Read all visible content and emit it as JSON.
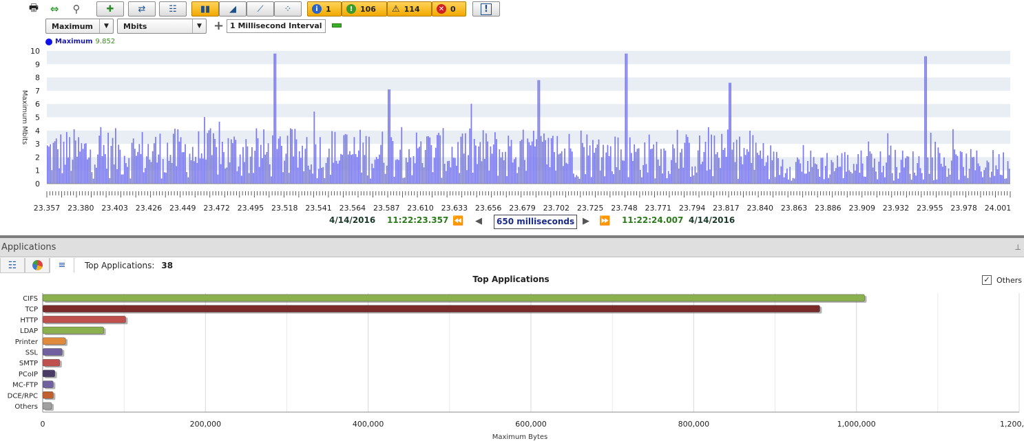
{
  "toolbar": {
    "icons": [
      "printer-icon",
      "refresh-arrows-icon",
      "binoculars-icon"
    ],
    "buttons": [
      "add-filter-icon",
      "swap-icon",
      "table-view-icon"
    ],
    "chart_type_buttons": [
      "bar-chart-icon",
      "area-chart-icon",
      "line-chart-icon",
      "scatter-chart-icon"
    ],
    "alerts": {
      "info": "1",
      "ok": "106",
      "warning": "114",
      "error": "0",
      "exclamation": "!"
    }
  },
  "controls": {
    "metric": "Maximum",
    "unit": "Mbits",
    "interval": "1 Millisecond Interval",
    "plus": "+"
  },
  "legend": {
    "name": "Maximum",
    "value": "9.852"
  },
  "timeline": {
    "start_date": "4/14/2016",
    "start_time": "11:22:23.357",
    "span": "650 milliseconds",
    "end_time": "11:22:24.007",
    "end_date": "4/14/2016"
  },
  "panel": {
    "title": "Applications",
    "pin": "⊥",
    "top_label": "Top Applications:",
    "top_count": "38",
    "others_checkbox": "Others",
    "others_checked": "✓"
  },
  "chart_data": [
    {
      "type": "bar",
      "title": "",
      "xlabel": "",
      "ylabel": "Maximum Mbits",
      "ylim": [
        0,
        10
      ],
      "yticks": [
        "0",
        "1",
        "2",
        "3",
        "4",
        "5",
        "6",
        "7",
        "8",
        "9",
        "10"
      ],
      "xticks": [
        "23.357",
        "23.380",
        "23.403",
        "23.426",
        "23.449",
        "23.472",
        "23.495",
        "23.518",
        "23.541",
        "23.564",
        "23.587",
        "23.610",
        "23.633",
        "23.656",
        "23.679",
        "23.702",
        "23.725",
        "23.748",
        "23.771",
        "23.794",
        "23.817",
        "23.840",
        "23.863",
        "23.886",
        "23.909",
        "23.932",
        "23.955",
        "23.978",
        "24.001"
      ],
      "series": [
        {
          "name": "Maximum",
          "color": "#7b7bef",
          "values": []
        }
      ],
      "bar_count": 650,
      "peaks": [
        {
          "x": "23.510",
          "y": 9.8
        },
        {
          "x": "23.587",
          "y": 7.1
        },
        {
          "x": "23.689",
          "y": 7.8
        },
        {
          "x": "23.748",
          "y": 9.8
        },
        {
          "x": "23.818",
          "y": 7.6
        },
        {
          "x": "23.950",
          "y": 9.6
        }
      ],
      "grid": "alternating bands"
    },
    {
      "type": "bar",
      "orientation": "horizontal",
      "title": "Top Applications",
      "xlabel": "Maximum Bytes",
      "ylabel": "",
      "xlim": [
        0,
        1200000
      ],
      "xticks": [
        "0",
        "200,000",
        "400,000",
        "600,000",
        "800,000",
        "1,000,000",
        "1,200,000"
      ],
      "categories": [
        "CIFS",
        "TCP",
        "HTTP",
        "LDAP",
        "Printer",
        "SSL",
        "SMTP",
        "PCoIP",
        "MC-FTP",
        "DCE/RPC",
        "Others"
      ],
      "values": [
        1010000,
        955000,
        102000,
        75000,
        28000,
        24000,
        21000,
        15000,
        13000,
        13000,
        11000
      ],
      "colors": [
        "#8bb04e",
        "#7b2a2a",
        "#c0504d",
        "#8bb04e",
        "#e08a3c",
        "#7060a0",
        "#c0504d",
        "#4a3a68",
        "#7060a0",
        "#c06030",
        "#a0a0a0"
      ]
    }
  ]
}
